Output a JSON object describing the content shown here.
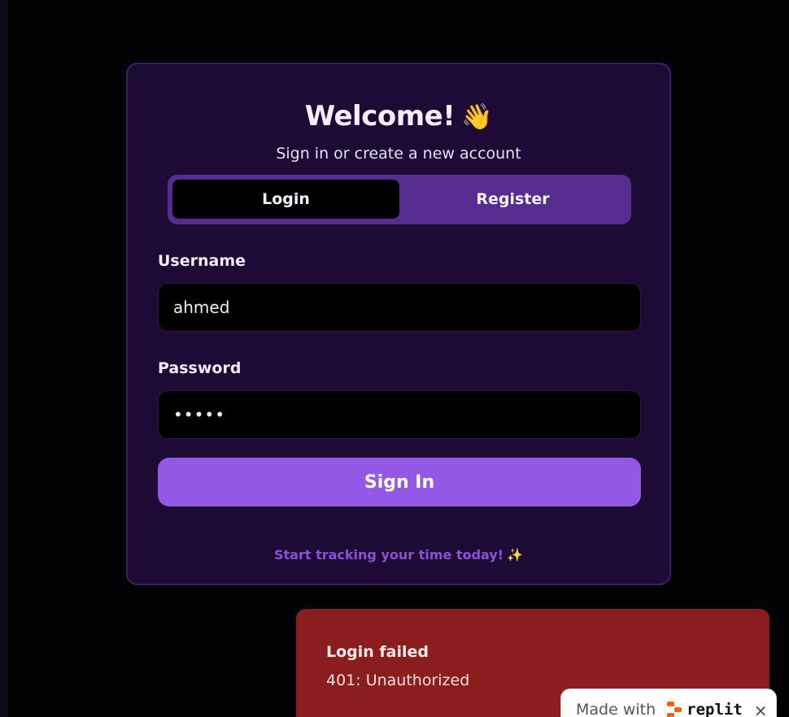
{
  "card": {
    "title": "Welcome!",
    "title_emoji": "👋",
    "subtitle": "Sign in or create a new account",
    "tabs": [
      {
        "label": "Login",
        "active": true
      },
      {
        "label": "Register",
        "active": false
      }
    ],
    "username_label": "Username",
    "username_value": "ahmed",
    "password_label": "Password",
    "password_value": "•••••",
    "signin_label": "Sign In",
    "footer_text": "Start tracking your time today!",
    "footer_emoji": "✨"
  },
  "toast": {
    "title": "Login failed",
    "message": "401: Unauthorized"
  },
  "badge": {
    "prefix": "Made with",
    "brand": "replit",
    "close": "×"
  },
  "colors": {
    "background": "#030204",
    "card": "#1e0b35",
    "accent": "#9458e6",
    "tab_bar": "#552c8f",
    "error": "#8a1e1e",
    "brand_orange": "#f26207"
  }
}
